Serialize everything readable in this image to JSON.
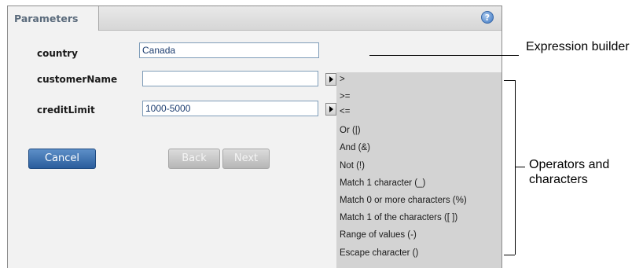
{
  "dialog": {
    "tab_label": "Parameters",
    "help_icon": "question-mark-icon"
  },
  "fields": [
    {
      "label": "country",
      "value": "Canada"
    },
    {
      "label": "customerName",
      "value": ""
    },
    {
      "label": "creditLimit",
      "value": "1000-5000"
    }
  ],
  "buttons": {
    "cancel": "Cancel",
    "back": "Back",
    "next": "Next"
  },
  "operators": [
    ">",
    ">=",
    "<=",
    "Or (|)",
    "And (&)",
    "Not (!)",
    "Match 1 character (_)",
    "Match 0 or more characters (%)",
    "Match 1 of the characters ([ ])",
    "Range of values (-)",
    "Escape character ()"
  ],
  "annotations": {
    "expression_builder": "Expression builder",
    "operators_and_characters": "Operators and characters"
  }
}
